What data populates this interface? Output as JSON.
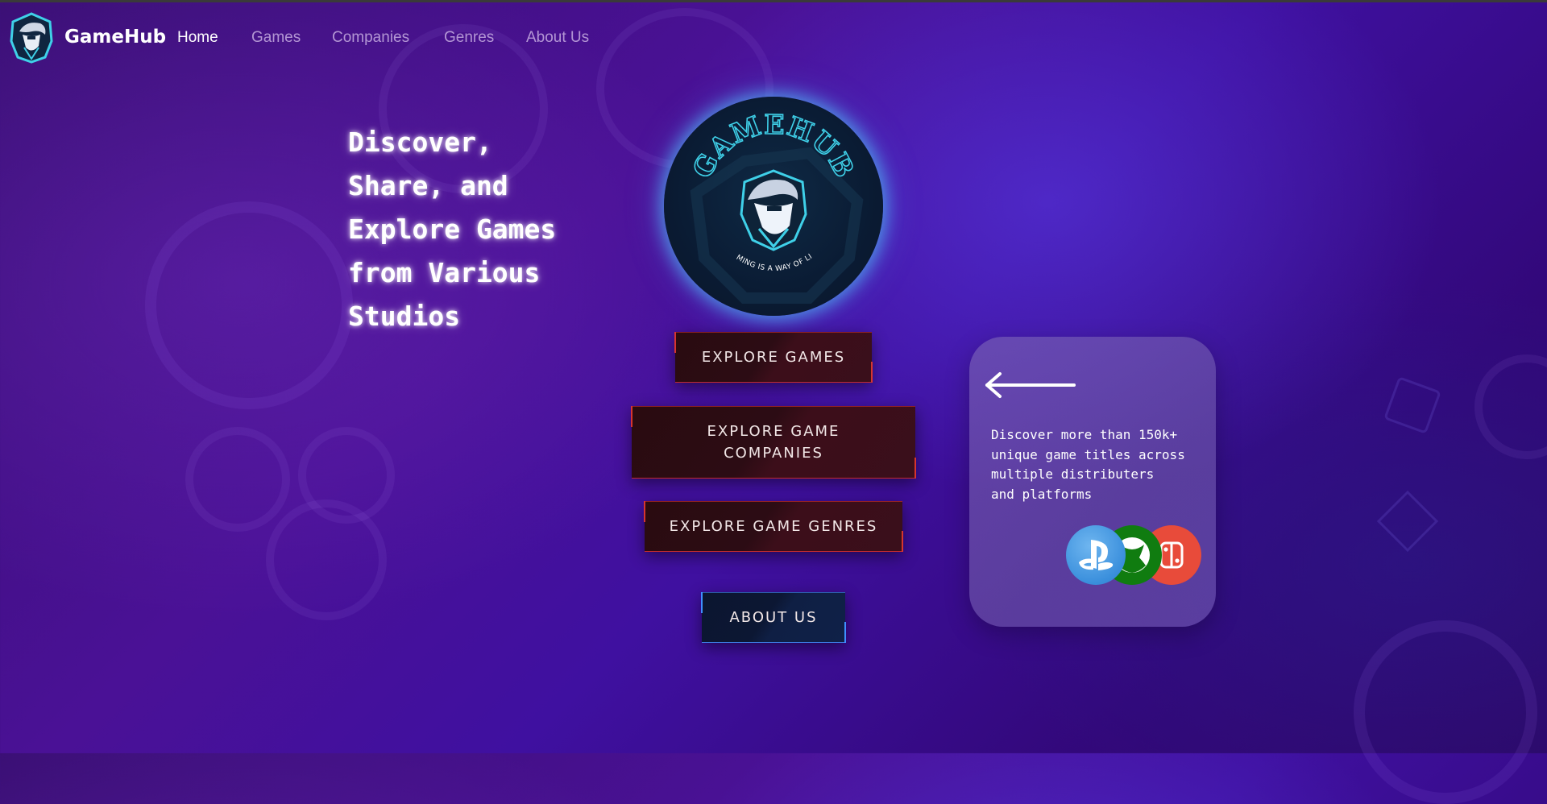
{
  "brand": {
    "name": "GameHub"
  },
  "nav": {
    "items": [
      {
        "label": "Home",
        "active": true
      },
      {
        "label": "Games",
        "active": false
      },
      {
        "label": "Companies",
        "active": false
      },
      {
        "label": "Genres",
        "active": false
      },
      {
        "label": "About Us",
        "active": false
      }
    ]
  },
  "hero": {
    "lines": [
      "Discover,",
      "Share, and",
      "Explore Games",
      "from Various",
      "Studios"
    ]
  },
  "logo": {
    "title": "GAMEHUB",
    "tagline": "GAMING IS A WAY OF LIFE"
  },
  "buttons": {
    "explore_games": "EXPLORE GAMES",
    "explore_companies_line1": "EXPLORE GAME",
    "explore_companies_line2": "COMPANIES",
    "explore_genres": "EXPLORE GAME GENRES",
    "about_us": "ABOUT US"
  },
  "card": {
    "lines": [
      "Discover more than 150k+",
      "unique game titles across",
      "multiple distributers",
      "and platforms"
    ],
    "platform_icons": [
      "playstation-icon",
      "xbox-icon",
      "nintendo-switch-icon"
    ]
  },
  "colors": {
    "accent_red": "#d6352f",
    "accent_blue": "#3f8fff",
    "logo_cyan": "#3fd0e8"
  }
}
